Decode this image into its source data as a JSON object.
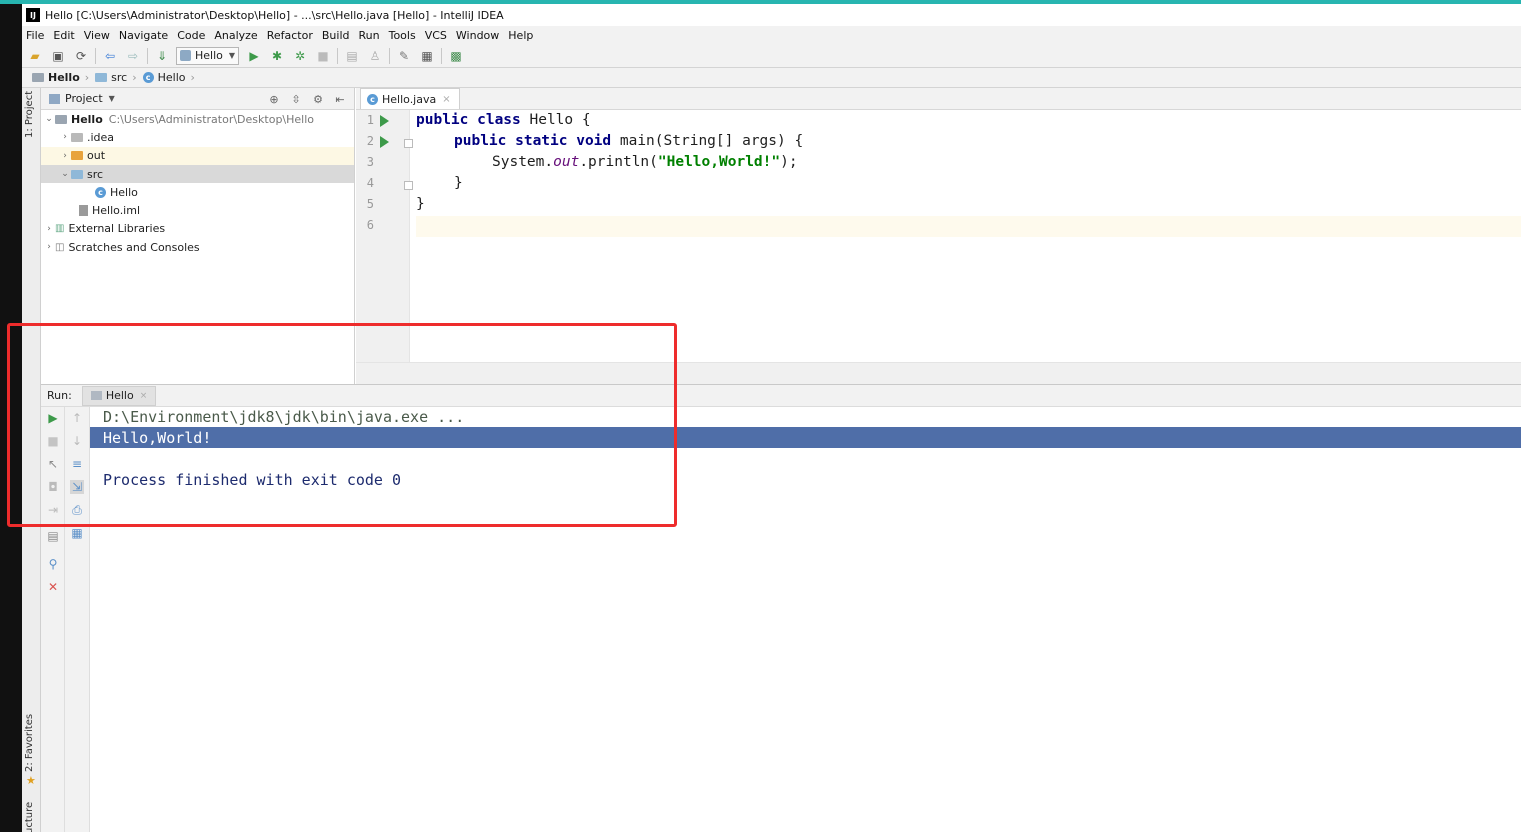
{
  "window": {
    "title": "Hello [C:\\Users\\Administrator\\Desktop\\Hello] - ...\\src\\Hello.java [Hello] - IntelliJ IDEA",
    "app_icon": "IJ"
  },
  "menu": [
    "File",
    "Edit",
    "View",
    "Navigate",
    "Code",
    "Analyze",
    "Refactor",
    "Build",
    "Run",
    "Tools",
    "VCS",
    "Window",
    "Help"
  ],
  "toolbar": {
    "run_config": "Hello"
  },
  "breadcrumbs": [
    "Hello",
    "src",
    "Hello"
  ],
  "side_tabs": {
    "project": "1: Project",
    "favorites": "2: Favorites",
    "structure": "ucture"
  },
  "project_panel": {
    "title": "Project",
    "tree": [
      {
        "label": "Hello",
        "hint": "C:\\Users\\Administrator\\Desktop\\Hello"
      },
      {
        "label": ".idea"
      },
      {
        "label": "out"
      },
      {
        "label": "src"
      },
      {
        "label": "Hello"
      },
      {
        "label": "Hello.iml"
      },
      {
        "label": "External Libraries"
      },
      {
        "label": "Scratches and Consoles"
      }
    ]
  },
  "editor": {
    "tab": "Hello.java",
    "line_numbers": [
      "1",
      "2",
      "3",
      "4",
      "5",
      "6"
    ],
    "code": {
      "l1_kw": "public class",
      "l1_rest": " Hello {",
      "l2_kw": "public static void",
      "l2_rest": " main(String[] args) {",
      "l3_a": "System.",
      "l3_field": "out",
      "l3_b": ".println(",
      "l3_str": "\"Hello,World!\"",
      "l3_c": ");",
      "l4": "}",
      "l5": "}"
    }
  },
  "run_panel": {
    "label": "Run:",
    "tab": "Hello",
    "console": [
      "D:\\Environment\\jdk8\\jdk\\bin\\java.exe ...",
      "Hello,World!",
      "",
      "Process finished with exit code 0"
    ]
  },
  "colors": {
    "accent_top": "#27b5b0",
    "annotation_box": "#ee2c2c",
    "selection": "#4f6ea8"
  }
}
